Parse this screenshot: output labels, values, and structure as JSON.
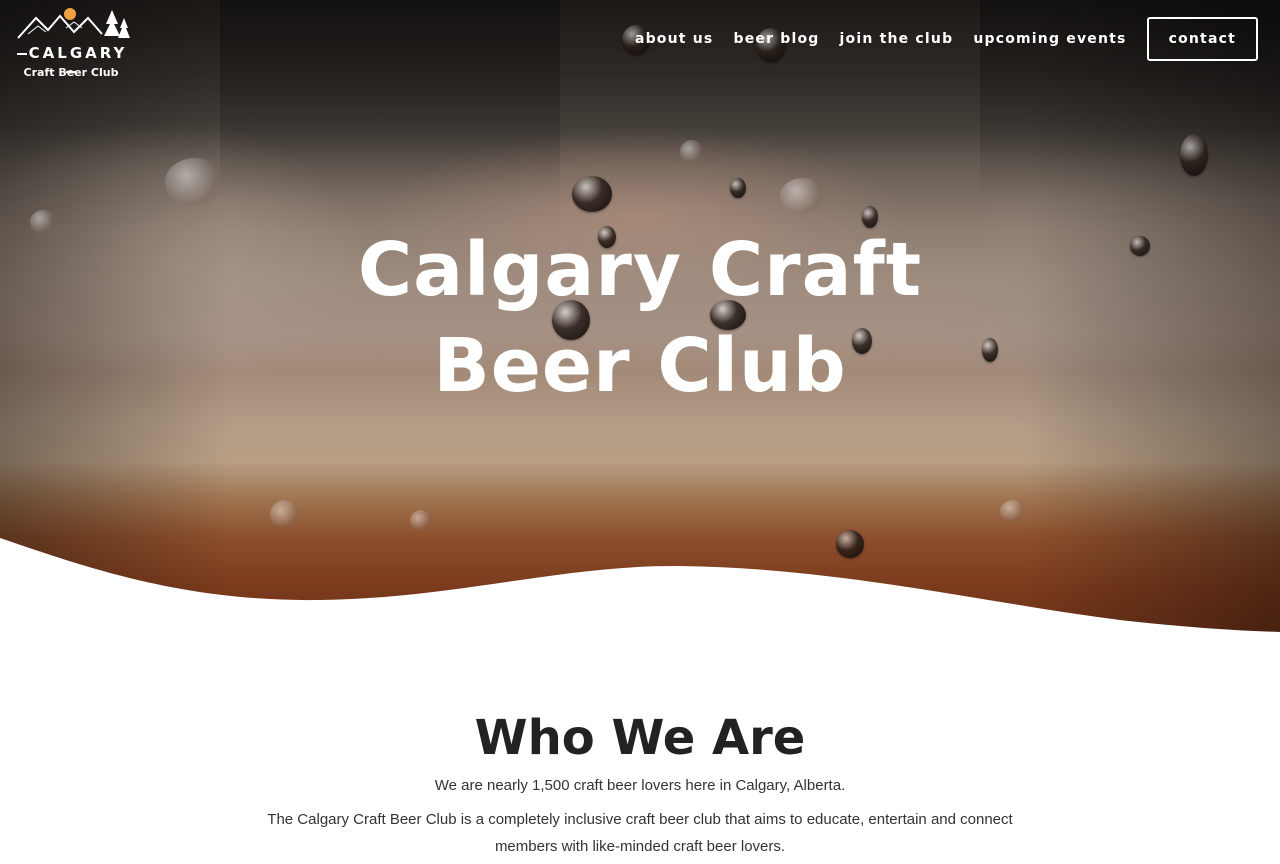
{
  "brand": {
    "logo_word": "CALGARY",
    "logo_sub": "Craft Beer Club"
  },
  "nav": {
    "items": [
      {
        "label": "about us"
      },
      {
        "label": "beer blog"
      },
      {
        "label": "join the club"
      },
      {
        "label": "upcoming events"
      }
    ],
    "cta_label": "contact"
  },
  "hero": {
    "title_line1": "Calgary Craft",
    "title_line2": "Beer Club"
  },
  "about": {
    "heading": "Who We Are",
    "paragraph1": "We are nearly 1,500 craft beer lovers here in Calgary, Alberta.",
    "paragraph2": "The Calgary Craft Beer Club is a completely inclusive craft beer club that aims to educate, entertain and connect members with like-minded craft beer lovers."
  },
  "colors": {
    "hero_top": "#2a2622",
    "hero_mid": "#a69184",
    "hero_bottom": "#7a3a1c",
    "text_dark": "#222222",
    "white": "#ffffff"
  }
}
